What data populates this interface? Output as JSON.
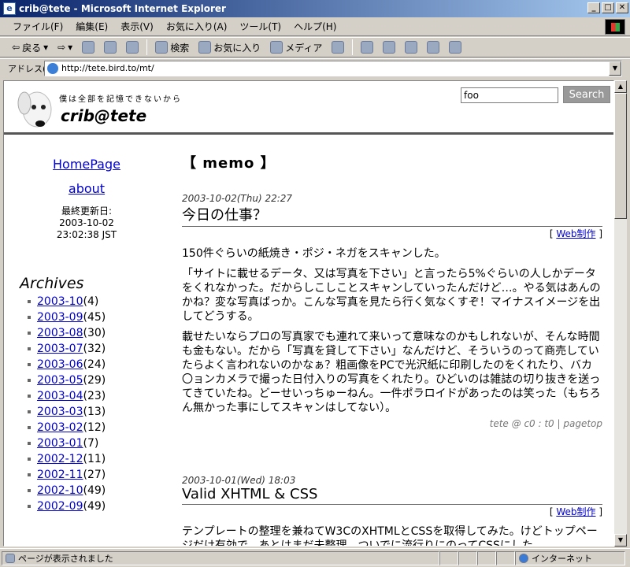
{
  "window": {
    "title": "crib@tete - Microsoft Internet Explorer",
    "min": "_",
    "max": "□",
    "close": "✕"
  },
  "menu": [
    "ファイル(F)",
    "編集(E)",
    "表示(V)",
    "お気に入り(A)",
    "ツール(T)",
    "ヘルプ(H)"
  ],
  "toolbar": {
    "back": "戻る",
    "search": "検索",
    "favorites": "お気に入り",
    "media": "メディア"
  },
  "address": {
    "label": "アドレス(D)",
    "url": "http://tete.bird.to/mt/"
  },
  "page": {
    "tagline": "僕は全部を記憶できないから",
    "title": "crib@tete",
    "search_value": "foo",
    "search_button": "Search",
    "links": [
      "HomePage",
      "about"
    ],
    "updated_label": "最終更新日:",
    "updated_date": "2003-10-02",
    "updated_time": "23:02:38 JST",
    "archives_title": "Archives",
    "archives": [
      {
        "month": "2003-10",
        "count": "(4)"
      },
      {
        "month": "2003-09",
        "count": "(45)"
      },
      {
        "month": "2003-08",
        "count": "(30)"
      },
      {
        "month": "2003-07",
        "count": "(32)"
      },
      {
        "month": "2003-06",
        "count": "(24)"
      },
      {
        "month": "2003-05",
        "count": "(29)"
      },
      {
        "month": "2003-04",
        "count": "(23)"
      },
      {
        "month": "2003-03",
        "count": "(13)"
      },
      {
        "month": "2003-02",
        "count": "(12)"
      },
      {
        "month": "2003-01",
        "count": "(7)"
      },
      {
        "month": "2002-12",
        "count": "(11)"
      },
      {
        "month": "2002-11",
        "count": "(27)"
      },
      {
        "month": "2002-10",
        "count": "(49)"
      },
      {
        "month": "2002-09",
        "count": "(49)"
      }
    ],
    "section_title": "【 memo 】",
    "entries": [
      {
        "date": "2003-10-02(Thu) 22:27",
        "title": "今日の仕事？",
        "category": "Web制作",
        "paragraphs": [
          "150件ぐらいの紙焼き・ポジ・ネガをスキャンした。",
          "「サイトに載せるデータ、又は写真を下さい」と言ったら5%ぐらいの人しかデータをくれなかった。だからしこしことスキャンしていったんだけど…。やる気はあんのかね？変な写真ばっか。こんな写真を見たら行く気なくすぞ！マイナスイメージを出してどうする。",
          "載せたいならプロの写真家でも連れて来いって意味なのかもしれないが、そんな時間も金もない。だから「写真を貸して下さい」なんだけど、そういうのって商売していたらよく言われないのかなぁ？粗画像をPCで光沢紙に印刷したのをくれたり、バカ〇ョンカメラで撮った日付入りの写真をくれたり。ひどいのは雑誌の切り抜きを送ってきていたね。どーせいっちゅーねん。一件ポラロイドがあったのは笑った（もちろん無かった事にしてスキャンはしてない）。"
        ],
        "footer": "tete @ c0 : t0 | pagetop"
      },
      {
        "date": "2003-10-01(Wed) 18:03",
        "title": "Valid XHTML & CSS",
        "category": "Web制作",
        "paragraphs": [
          "テンプレートの整理を兼ねてW3CのXHTMLとCSSを取得してみた。けどトップページだけ有効で、あとはまだ未整理。ついでに流行りにのってCSSにした"
        ],
        "footer": ""
      }
    ]
  },
  "status": {
    "text": "ページが表示されました",
    "zone": "インターネット"
  }
}
